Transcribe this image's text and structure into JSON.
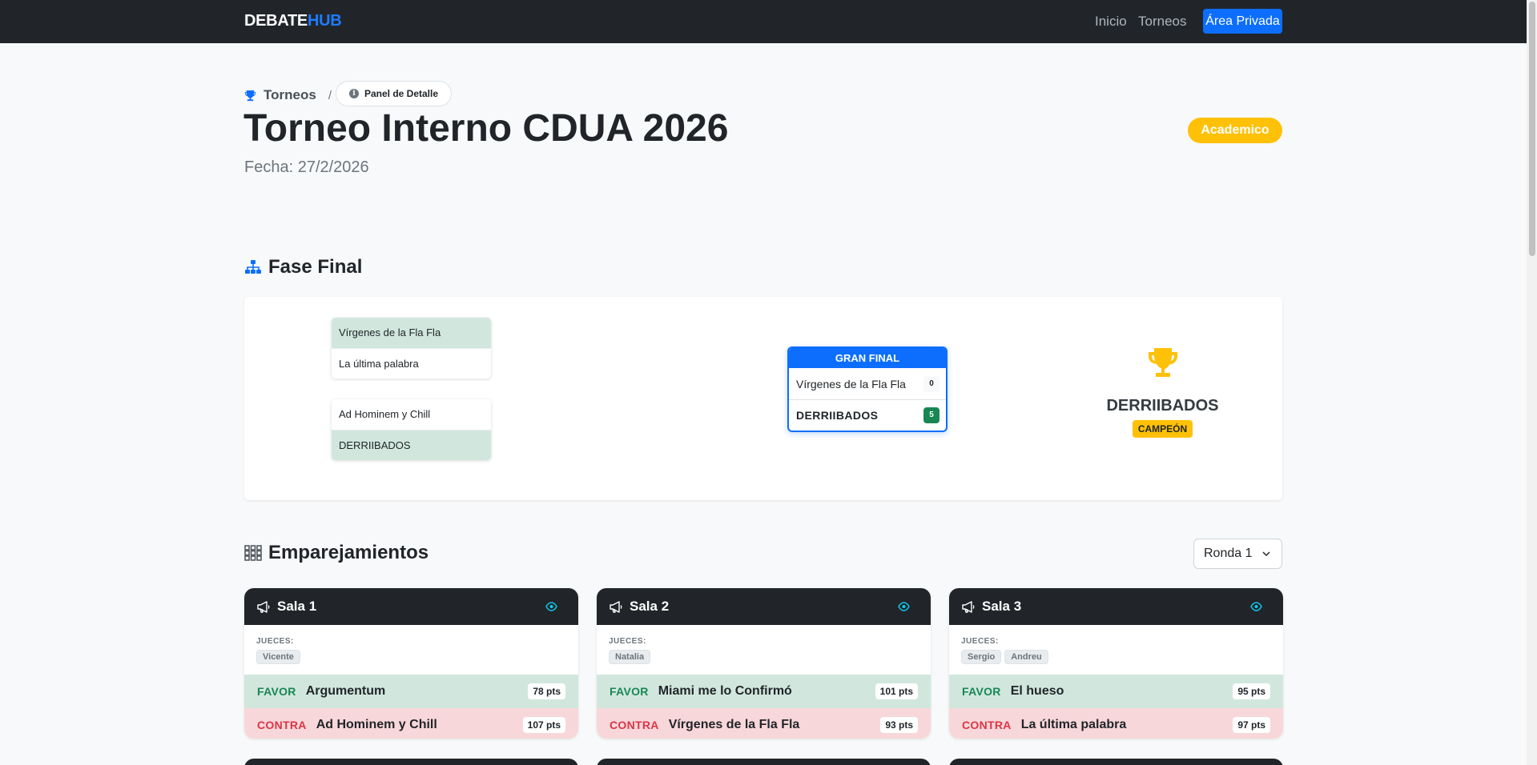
{
  "navbar": {
    "brand_a": "DEBATE",
    "brand_b": "HUB",
    "links": [
      "Inicio",
      "Torneos"
    ],
    "private_label": "Área Privada",
    "accent": "#0d6efd"
  },
  "breadcrumb": {
    "root": "Torneos",
    "separator": "/",
    "current": "Panel de Detalle",
    "icon": "trophy-icon"
  },
  "tournament": {
    "title": "Torneo Interno CDUA 2026",
    "date_text": "Fecha: 27/2/2026",
    "category": "Academico",
    "category_color": "#ffc107"
  },
  "final_phase": {
    "heading": "Fase Final",
    "semifinals": [
      {
        "teams": [
          {
            "name": "Vírgenes de la Fla Fla",
            "winner": true
          },
          {
            "name": "La última palabra",
            "winner": false
          }
        ]
      },
      {
        "teams": [
          {
            "name": "Ad Hominem y Chill",
            "winner": false
          },
          {
            "name": "DERRIIBADOS",
            "winner": true
          }
        ]
      }
    ],
    "grand_final": {
      "label": "GRAN FINAL",
      "teams": [
        {
          "name": "Vírgenes de la Fla Fla",
          "score": "0"
        },
        {
          "name": "DERRIIBADOS",
          "score": "5"
        }
      ]
    },
    "champion": {
      "name": "DERRIIBADOS",
      "label": "CAMPEÓN"
    }
  },
  "pairings": {
    "heading": "Emparejamientos",
    "round_selected": "Ronda 1",
    "judges_label": "JUECES:",
    "favor_label": "FAVOR",
    "contra_label": "CONTRA",
    "rooms": [
      {
        "name": "Sala 1",
        "judges": [
          "Vicente"
        ],
        "favor": {
          "team": "Argumentum",
          "pts": "78 pts"
        },
        "contra": {
          "team": "Ad Hominem y Chill",
          "pts": "107 pts"
        }
      },
      {
        "name": "Sala 2",
        "judges": [
          "Natalia"
        ],
        "favor": {
          "team": "Miami me lo Confirmó",
          "pts": "101 pts"
        },
        "contra": {
          "team": "Vírgenes de la Fla Fla",
          "pts": "93 pts"
        }
      },
      {
        "name": "Sala 3",
        "judges": [
          "Sergio",
          "Andreu"
        ],
        "favor": {
          "team": "El hueso",
          "pts": "95 pts"
        },
        "contra": {
          "team": "La última palabra",
          "pts": "97 pts"
        }
      }
    ]
  }
}
